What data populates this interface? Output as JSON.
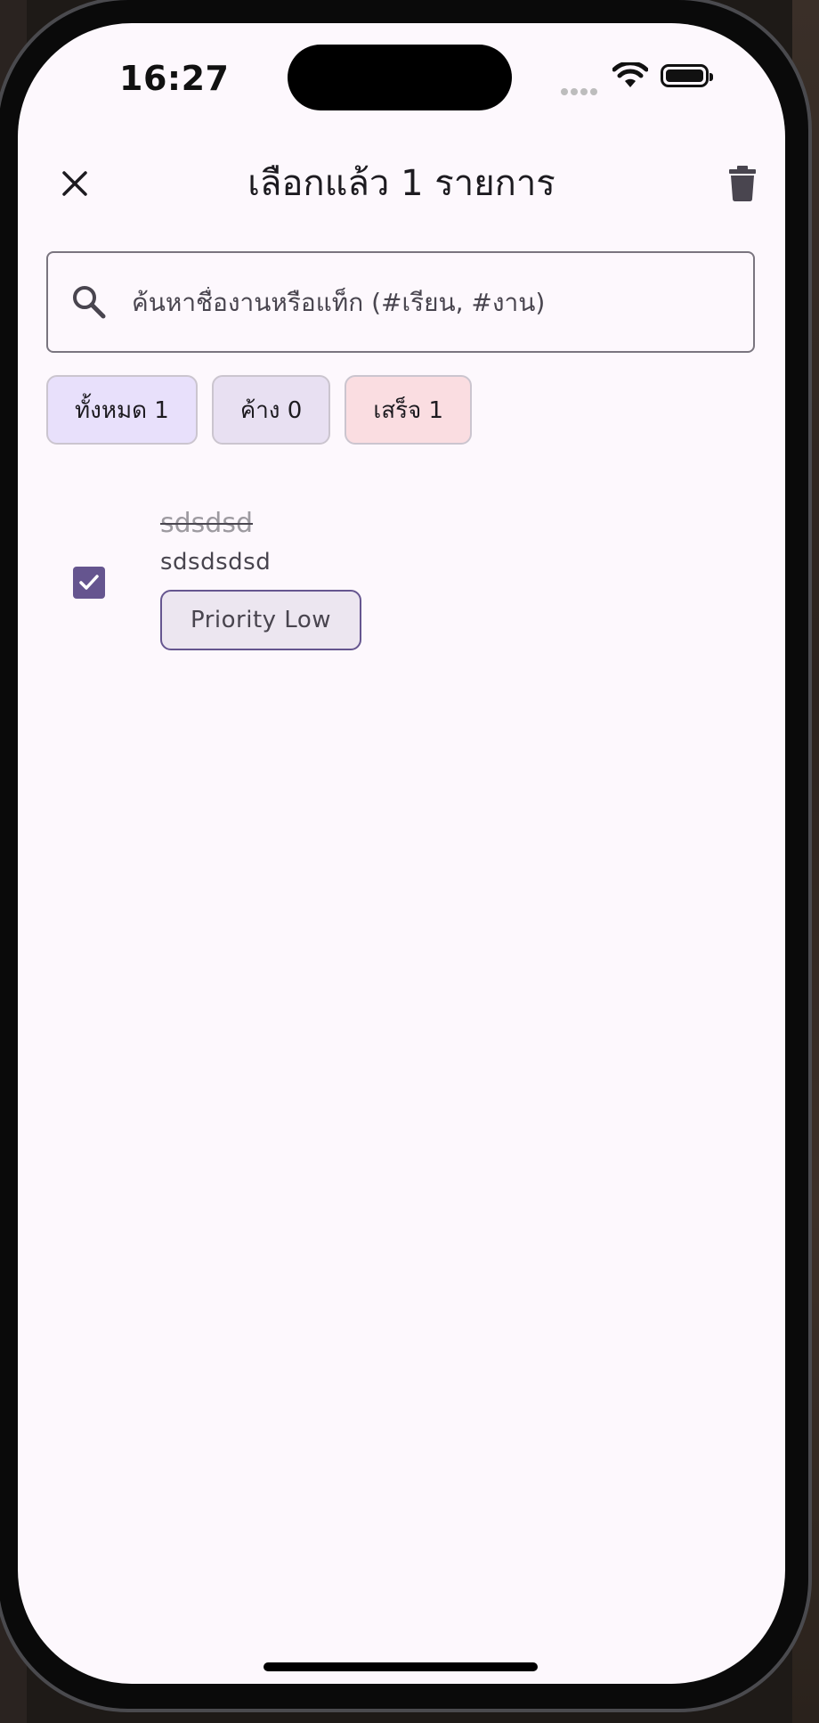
{
  "status_bar": {
    "time": "16:27"
  },
  "app_bar": {
    "title": "เลือกแล้ว 1 รายการ",
    "close_icon": "close-icon",
    "delete_icon": "trash-icon"
  },
  "search": {
    "placeholder": "ค้นหาชื่องานหรือแท็ก (#เรียน, #งาน)",
    "value": ""
  },
  "filters": [
    {
      "label": "ทั้งหมด 1",
      "color": "#e8e0fb"
    },
    {
      "label": "ค้าง 0",
      "color": "#e8e0f2"
    },
    {
      "label": "เสร็จ 1",
      "color": "#fadde1"
    }
  ],
  "tasks": [
    {
      "title": "sdsdsd",
      "subtitle": "sdsdsdsd",
      "priority": "Priority Low",
      "completed": true
    }
  ],
  "colors": {
    "accent": "#65558f",
    "background": "#fdf8fd"
  }
}
